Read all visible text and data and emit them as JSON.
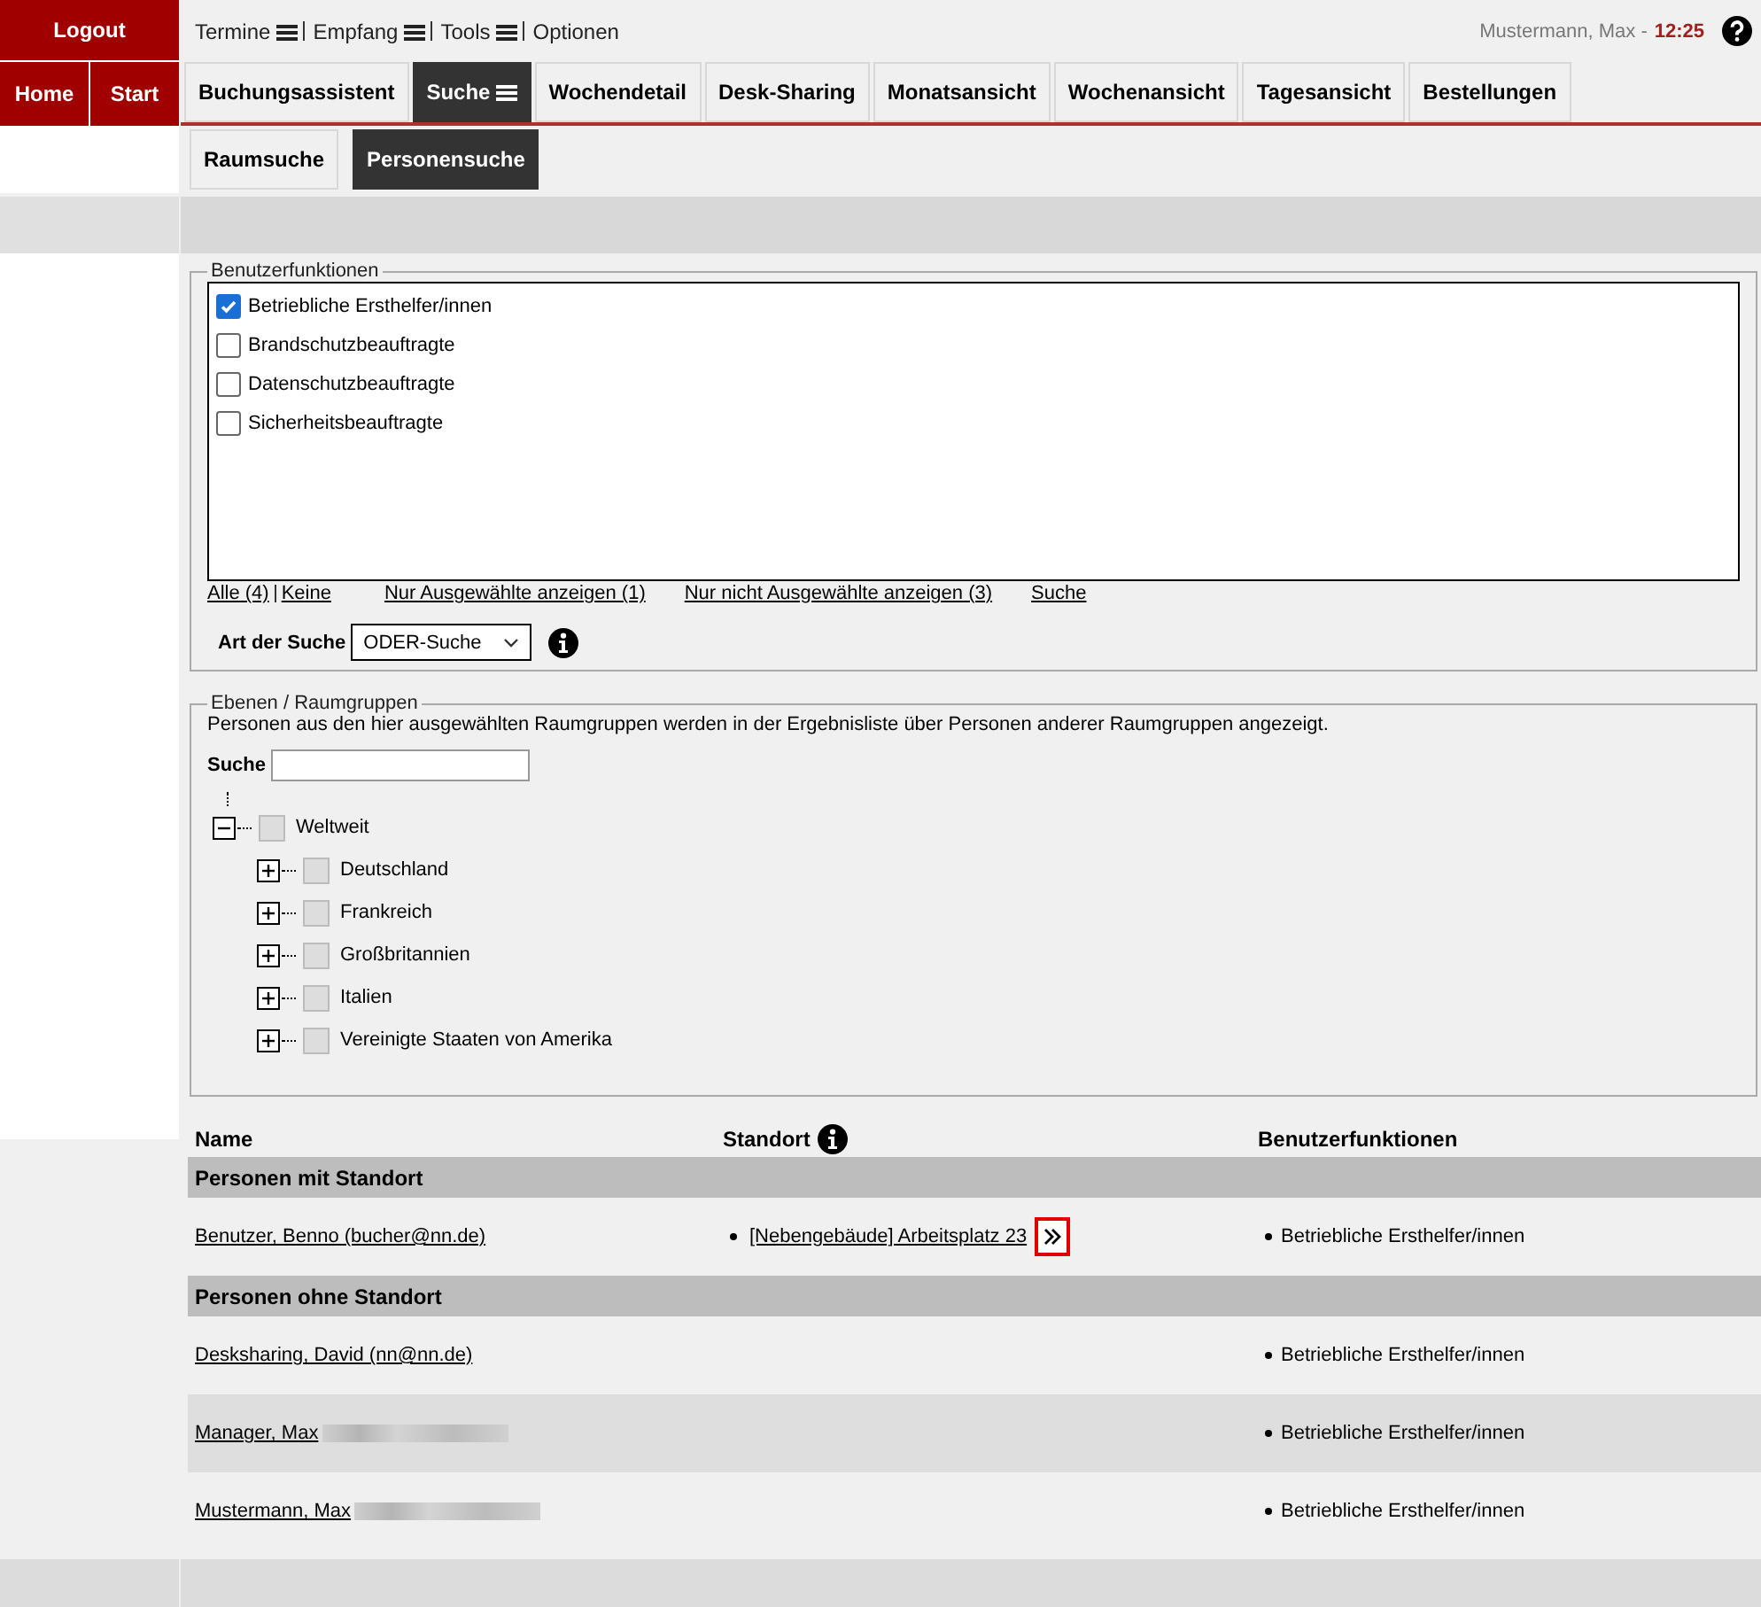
{
  "top_menu": [
    {
      "label": "Termine",
      "has_menu": true
    },
    {
      "label": "Empfang",
      "has_menu": true
    },
    {
      "label": "Tools",
      "has_menu": true
    },
    {
      "label": "Optionen",
      "has_menu": false
    }
  ],
  "logout": "Logout",
  "user": "Mustermann, Max -",
  "time": "12:25",
  "side_buttons": [
    "Home",
    "Start"
  ],
  "tabs": [
    {
      "label": "Buchungsassistent",
      "selected": false,
      "has_menu": false
    },
    {
      "label": "Suche",
      "selected": true,
      "has_menu": true
    },
    {
      "label": "Wochendetail",
      "selected": false,
      "has_menu": false
    },
    {
      "label": "Desk-Sharing",
      "selected": false,
      "has_menu": false
    },
    {
      "label": "Monatsansicht",
      "selected": false,
      "has_menu": false
    },
    {
      "label": "Wochenansicht",
      "selected": false,
      "has_menu": false
    },
    {
      "label": "Tagesansicht",
      "selected": false,
      "has_menu": false
    },
    {
      "label": "Bestellungen",
      "selected": false,
      "has_menu": false
    }
  ],
  "subtabs": [
    {
      "label": "Raumsuche",
      "selected": false
    },
    {
      "label": "Personensuche",
      "selected": true
    }
  ],
  "functions": {
    "legend": "Benutzerfunktionen",
    "items": [
      {
        "label": "Betriebliche Ersthelfer/innen",
        "checked": true
      },
      {
        "label": "Brandschutzbeauftragte",
        "checked": false
      },
      {
        "label": "Datenschutzbeauftragte",
        "checked": false
      },
      {
        "label": "Sicherheitsbeauftragte",
        "checked": false
      }
    ],
    "links": [
      "Alle (4)",
      "Keine",
      "Nur Ausgewählte anzeigen (1)",
      "Nur nicht Ausgewählte anzeigen (3)",
      "Suche"
    ],
    "search_type_label": "Art der Suche",
    "search_type": "ODER-Suche"
  },
  "groups": {
    "legend": "Ebenen / Raumgruppen",
    "hint": "Personen aus den hier ausgewählten Raumgruppen werden in der Ergebnisliste über Personen anderer Raumgruppen angezeigt.",
    "search_label": "Suche",
    "tree": [
      {
        "label": "Weltweit",
        "expanded": true,
        "checked": false,
        "children": [
          {
            "label": "Deutschland",
            "expanded": false,
            "checked": false
          },
          {
            "label": "Frankreich",
            "expanded": false,
            "checked": false
          },
          {
            "label": "Großbritannien",
            "expanded": false,
            "checked": false
          },
          {
            "label": "Italien",
            "expanded": false,
            "checked": false
          },
          {
            "label": "Vereinigte Staaten von Amerika",
            "expanded": false,
            "checked": false
          }
        ]
      }
    ]
  },
  "results": {
    "columns": [
      "Name",
      "Standort",
      "Benutzerfunktionen"
    ],
    "sections": [
      {
        "title": "Personen mit Standort",
        "rows": [
          {
            "name": "Benutzer, Benno (bucher@nn.de)",
            "redacted": false,
            "location": "[Nebengebäude] Arbeitsplatz 23",
            "functions": [
              "Betriebliche Ersthelfer/innen"
            ]
          }
        ]
      },
      {
        "title": "Personen ohne Standort",
        "rows": [
          {
            "name": "Desksharing, David (nn@nn.de)",
            "redacted": false,
            "functions": [
              "Betriebliche Ersthelfer/innen"
            ]
          },
          {
            "name": "Manager, Max",
            "redacted": true,
            "functions": [
              "Betriebliche Ersthelfer/innen"
            ]
          },
          {
            "name": "Mustermann, Max",
            "redacted": true,
            "functions": [
              "Betriebliche Ersthelfer/innen"
            ]
          }
        ]
      }
    ]
  }
}
